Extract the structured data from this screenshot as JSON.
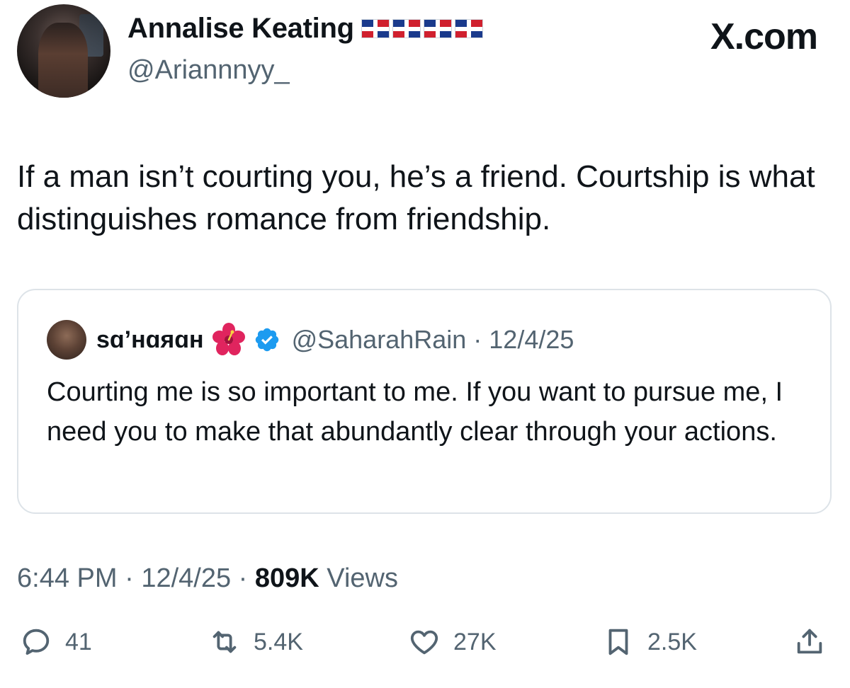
{
  "author": {
    "display_name": "Annalise Keating",
    "handle": "@Ariannnyy_",
    "flag_count": 4,
    "flag_icon": "dominican-republic-flag-icon"
  },
  "site_label": "X.com",
  "tweet": {
    "text": "If a man isn’t courting you, he’s a friend. Courtship is what distinguishes romance from friendship."
  },
  "quoted_tweet": {
    "display_name": "sɑ’нɑяɑн",
    "handle": "@SaharahRain",
    "separator": "·",
    "date": "12/4/25",
    "text": "Courting me is so important to me. If you want to pursue me, I need you to make that abundantly clear through your actions."
  },
  "meta": {
    "time": "6:44 PM",
    "separator": "·",
    "date": "12/4/25",
    "views_count": "809K",
    "views_label": "Views"
  },
  "actions": {
    "replies": "41",
    "reposts": "5.4K",
    "likes": "27K",
    "bookmarks": "2.5K"
  },
  "colors": {
    "text_primary": "#0f1419",
    "text_secondary": "#536471",
    "border": "#dde3e8",
    "verified_blue": "#1d9bf0"
  }
}
